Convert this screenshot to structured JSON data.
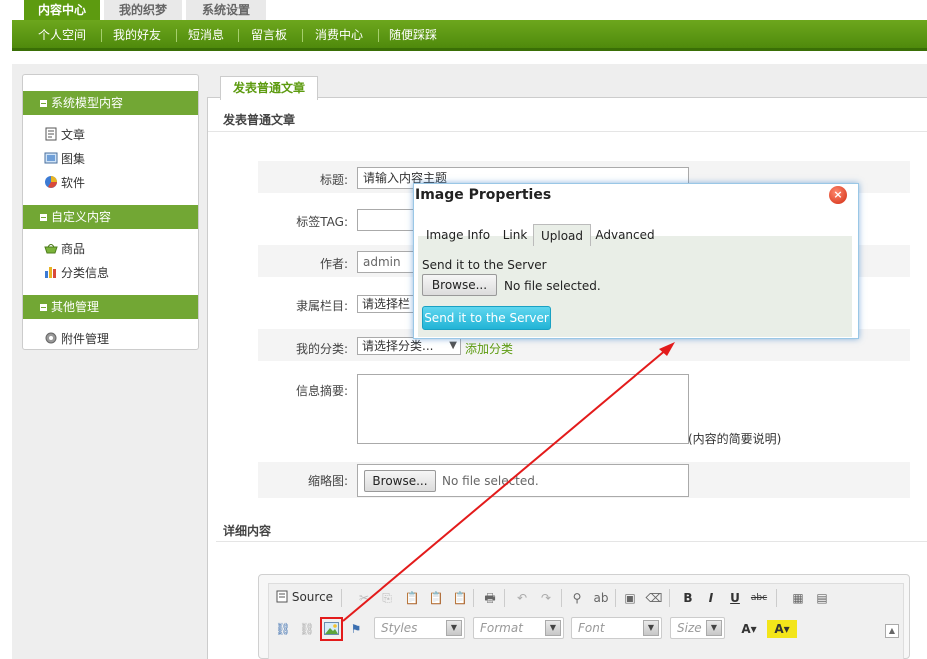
{
  "top_tabs": [
    "内容中心",
    "我的织梦",
    "系统设置"
  ],
  "nav": [
    "个人空间",
    "我的好友",
    "短消息",
    "留言板",
    "消费中心",
    "随便踩踩"
  ],
  "sidebar": {
    "groups": [
      {
        "title": "系统模型内容",
        "items": [
          "文章",
          "图集",
          "软件"
        ]
      },
      {
        "title": "自定义内容",
        "items": [
          "商品",
          "分类信息"
        ]
      },
      {
        "title": "其他管理",
        "items": [
          "附件管理"
        ]
      }
    ]
  },
  "content": {
    "tab": "发表普通文章",
    "section_title": "发表普通文章",
    "fields": {
      "title_label": "标题:",
      "title_value": "请输入内容主题",
      "tag_label": "标签TAG:",
      "author_label": "作者:",
      "author_value": "admin",
      "column_label": "隶属栏目:",
      "column_value": "请选择栏",
      "category_label": "我的分类:",
      "category_value": "请选择分类...",
      "add_category": "添加分类",
      "summary_label": "信息摘要:",
      "summary_hint": "(内容的简要说明)",
      "thumb_label": "缩略图:",
      "thumb_browse": "Browse...",
      "thumb_status": "No file selected."
    },
    "detail_title": "详细内容"
  },
  "editor": {
    "source_label": "Source",
    "combos": [
      "Styles",
      "Format",
      "Font",
      "Size"
    ]
  },
  "dialog": {
    "title": "Image Properties",
    "close": "×",
    "tabs": [
      "Image Info",
      "Link",
      "Upload",
      "Advanced"
    ],
    "active_tab": "Upload",
    "upload_label": "Send it to the Server",
    "browse": "Browse...",
    "file_status": "No file selected.",
    "send_button": "Send it to the Server"
  },
  "colors": {
    "brand_green": "#5d9b10",
    "arrow_red": "#e31b1b",
    "send_button": "#22b4d6"
  }
}
